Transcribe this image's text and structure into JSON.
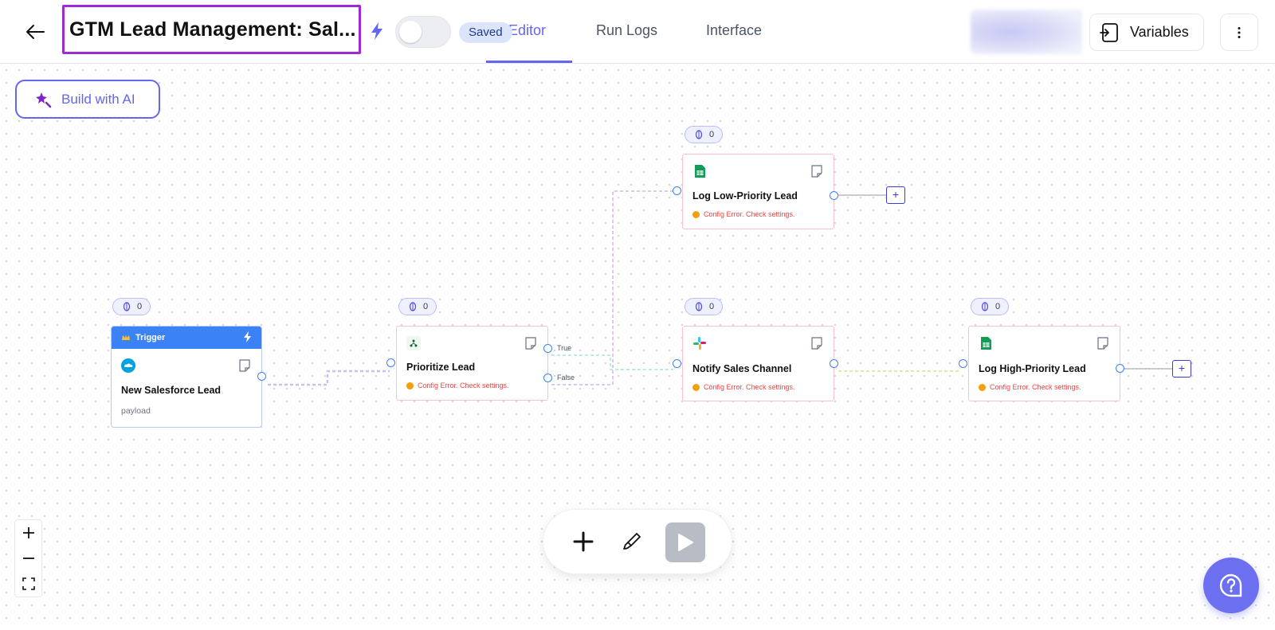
{
  "header": {
    "title": "GTM Lead Management: Sal...",
    "saved_label": "Saved",
    "tabs": [
      {
        "label": "Editor",
        "active": true
      },
      {
        "label": "Run Logs",
        "active": false
      },
      {
        "label": "Interface",
        "active": false
      }
    ],
    "variables_label": "Variables"
  },
  "canvas": {
    "build_ai_label": "Build with AI",
    "nodes": [
      {
        "id": "trigger",
        "header": "Trigger",
        "title": "New Salesforce Lead",
        "subtitle": "payload",
        "counter": "0",
        "icon": "salesforce-icon"
      },
      {
        "id": "prioritize",
        "title": "Prioritize Lead",
        "error": "Config Error. Check settings.",
        "counter": "0",
        "icon": "branch-icon"
      },
      {
        "id": "log-low",
        "title": "Log Low-Priority Lead",
        "error": "Config Error. Check settings.",
        "counter": "0",
        "icon": "google-sheets-icon"
      },
      {
        "id": "notify",
        "title": "Notify Sales Channel",
        "error": "Config Error. Check settings.",
        "counter": "0",
        "icon": "slack-icon"
      },
      {
        "id": "log-high",
        "title": "Log High-Priority Lead",
        "error": "Config Error. Check settings.",
        "counter": "0",
        "icon": "google-sheets-icon"
      }
    ],
    "edge_labels": {
      "true": "True",
      "false": "False"
    },
    "plus": "+"
  },
  "colors": {
    "accent": "#6366f1",
    "title_border": "#9b2bd6",
    "trigger_header": "#3b82f6",
    "error_text": "#ef4444",
    "error_border": "#fbc2cd"
  }
}
